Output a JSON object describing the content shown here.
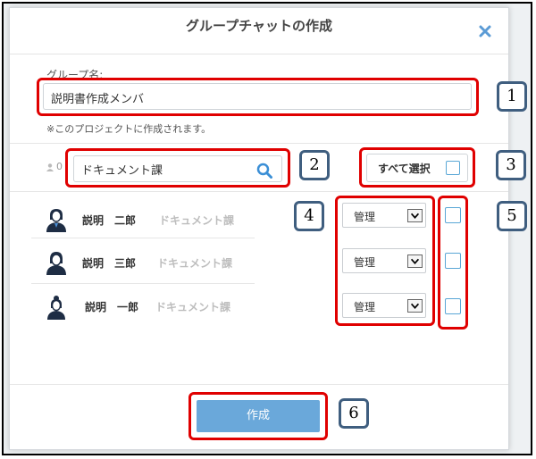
{
  "dialog": {
    "title": "グループチャットの作成"
  },
  "form": {
    "group_label": "グループ名:",
    "group_value": "説明書作成メンバ",
    "note": "※このプロジェクトに作成されます。"
  },
  "search": {
    "member_count": "0",
    "value": "ドキュメント課"
  },
  "select_all": {
    "label": "すべて選択"
  },
  "members": [
    {
      "name": "説明　二郎",
      "dept": "ドキュメント課",
      "role": "管理"
    },
    {
      "name": "説明　三郎",
      "dept": "ドキュメント課",
      "role": "管理"
    },
    {
      "name": "説明　一郎",
      "dept": "ドキュメント課",
      "role": "管理"
    }
  ],
  "create_button": {
    "label": "作成"
  },
  "annotations": [
    "1",
    "2",
    "3",
    "4",
    "5",
    "6"
  ],
  "colors": {
    "accent": "#6aa8da",
    "highlight": "#e00000",
    "badge_border": "#3f5e7f"
  }
}
